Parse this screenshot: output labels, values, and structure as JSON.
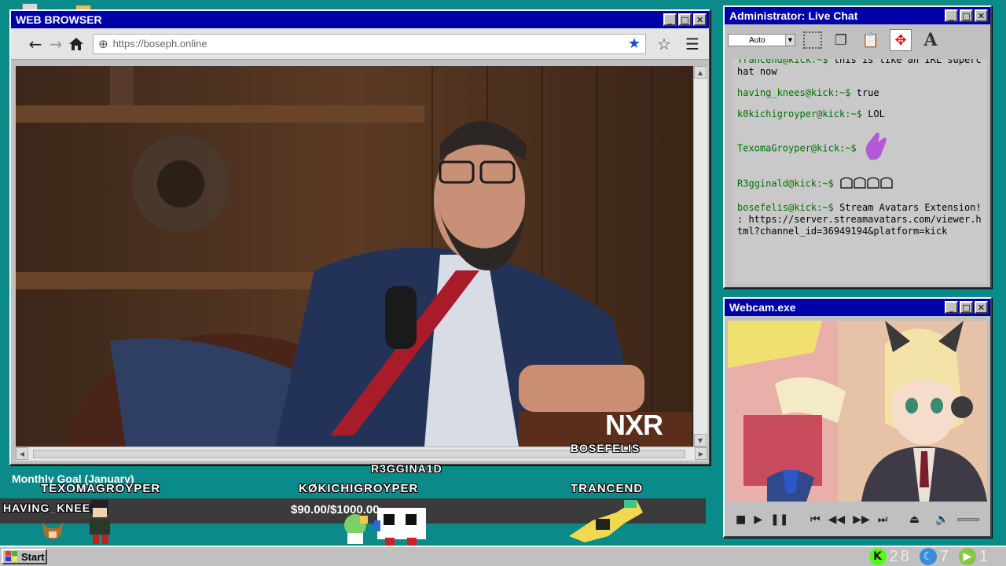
{
  "browser": {
    "title": "WEB BROWSER",
    "url": "https://boseph.online",
    "watermark": "NXR",
    "controls": {
      "minimize": "_",
      "maximize": "□",
      "close": "✕"
    }
  },
  "chat": {
    "title": "Administrator: Live Chat",
    "font_size_option": "Auto",
    "messages": [
      {
        "user": "Trancend@kick:~$",
        "text": "this is like an IRL superchat now"
      },
      {
        "user": "having_knees@kick:~$",
        "text": "true"
      },
      {
        "user": "k0kichigroyper@kick:~$",
        "text": "LOL"
      },
      {
        "user": "TexomaGroyper@kick:~$",
        "text": "",
        "emote": "purple-hand"
      },
      {
        "user": "R3gginald@kick:~$",
        "text": "",
        "emote": "emote-row"
      },
      {
        "user": "bosefelis@kick:~$",
        "text": "Stream Avatars Extension! : https://server.streamavatars.com/viewer.html?channel_id=36949194&platform=kick"
      }
    ]
  },
  "webcam": {
    "title": "Webcam.exe"
  },
  "overlay": {
    "goal_label": "Monthly Goal (January)",
    "goal_amount": "$90.00/$1000.00",
    "goal_progress": 0.09,
    "avatars": {
      "texomagroyper": "TEXOMAGROYPER",
      "having_knees": "HAVING_KNEES",
      "r3gginald": "R3GGINA1D",
      "kokichigroyper": "KØKICHIGROYPER",
      "trancend": "TRANCEND",
      "bosefelis": "BOSEFELIS"
    }
  },
  "taskbar": {
    "start_label": "Start",
    "tray": [
      {
        "icon": "kick-icon",
        "value": "28",
        "color": "#53fc18"
      },
      {
        "icon": "moon-icon",
        "value": "7",
        "color": "#3a8bd8"
      },
      {
        "icon": "rumble-icon",
        "value": "1",
        "color": "#85c742"
      }
    ]
  }
}
